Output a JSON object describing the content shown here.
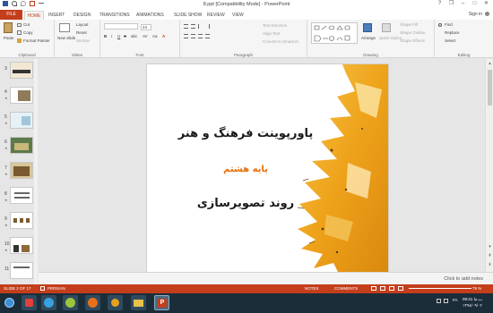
{
  "window": {
    "title": "8.ppt [Compatibility Mode] - PowerPoint",
    "help": "?",
    "restore": "❐",
    "minimize": "–",
    "maximize": "□",
    "close": "✕"
  },
  "ribbon_tabs": [
    "FILE",
    "HOME",
    "INSERT",
    "DESIGN",
    "TRANSITIONS",
    "ANIMATIONS",
    "SLIDE SHOW",
    "REVIEW",
    "VIEW"
  ],
  "signin": "Sign in",
  "groups": {
    "clipboard": {
      "label": "Clipboard",
      "paste": "Paste",
      "cut": "Cut",
      "copy": "Copy",
      "format_painter": "Format Painter"
    },
    "slides": {
      "label": "Slides",
      "new_slide": "New Slide",
      "layout": "Layout",
      "reset": "Reset",
      "section": "Section"
    },
    "font": {
      "label": "Font",
      "font_size": "24",
      "bold": "B",
      "italic": "I",
      "underline": "U",
      "strike": "S",
      "shadow": "abc",
      "spacing": "AV",
      "case": "Aa",
      "color": "A"
    },
    "paragraph": {
      "label": "Paragraph",
      "text_direction": "Text Direction",
      "align_text": "Align Text",
      "smartart": "Convert to SmartArt"
    },
    "drawing": {
      "label": "Drawing",
      "arrange": "Arrange",
      "quick_styles": "Quick Styles",
      "shape_fill": "Shape Fill",
      "shape_outline": "Shape Outline",
      "shape_effects": "Shape Effects"
    },
    "editing": {
      "label": "Editing",
      "find": "Find",
      "replace": "Replace",
      "select": "Select"
    }
  },
  "thumbnails": [
    {
      "num": "3"
    },
    {
      "num": "4"
    },
    {
      "num": "5"
    },
    {
      "num": "6"
    },
    {
      "num": "7"
    },
    {
      "num": "8"
    },
    {
      "num": "9"
    },
    {
      "num": "10"
    },
    {
      "num": "11"
    }
  ],
  "slide": {
    "title": "پاورپوینت فرهنگ و هنر",
    "subtitle": "پایه هشتم",
    "body": "روند تصویرسازی"
  },
  "notes_placeholder": "Click to add notes",
  "status": {
    "slide_info": "SLIDE 2 OF 17",
    "language": "PERSIAN",
    "notes": "NOTES",
    "comments": "COMMENTS",
    "zoom": "79 %"
  },
  "tray": {
    "time": "09:41 ب.ظ",
    "lang": "FA",
    "date": "۱۳۹۸/۰۹/۰۲"
  },
  "colors": {
    "accent": "#c43e1c",
    "slide_title": "#1a1a1a",
    "slide_subtitle": "#e8700a",
    "paint_orange": "#f0a81c",
    "taskbar": "#1c2d3a"
  }
}
